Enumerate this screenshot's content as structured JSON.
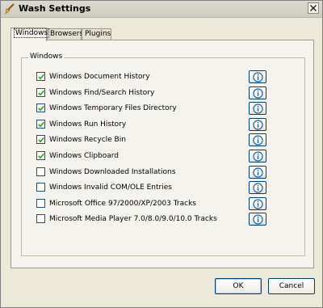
{
  "window": {
    "title": "Wash Settings"
  },
  "tabs": [
    {
      "label": "Windows",
      "active": true
    },
    {
      "label": "Browsers",
      "active": false
    },
    {
      "label": "Plugins",
      "active": false
    }
  ],
  "group": {
    "label": "Windows",
    "items": [
      {
        "label": "Windows Document History",
        "checked": true
      },
      {
        "label": "Windows Find/Search History",
        "checked": true
      },
      {
        "label": "Windows Temporary Files Directory",
        "checked": true
      },
      {
        "label": "Windows Run History",
        "checked": true
      },
      {
        "label": "Windows Recycle Bin",
        "checked": true
      },
      {
        "label": "Windows Clipboard",
        "checked": true
      },
      {
        "label": "Windows Downloaded Installations",
        "checked": false
      },
      {
        "label": "Windows Invalid COM/OLE Entries",
        "checked": false
      },
      {
        "label": "Microsoft Office 97/2000/XP/2003 Tracks",
        "checked": false
      },
      {
        "label": "Microsoft Media Player 7.0/8.0/9.0/10.0 Tracks",
        "checked": false
      }
    ]
  },
  "buttons": {
    "ok": "OK",
    "cancel": "Cancel"
  },
  "colors": {
    "accent_border": "#003c74",
    "checkmark": "#21a121",
    "info_icon": "#1b5fb0"
  },
  "icons": {
    "app": "broom-icon",
    "close": "close-icon",
    "info": "info-icon",
    "check": "checkmark-icon"
  }
}
